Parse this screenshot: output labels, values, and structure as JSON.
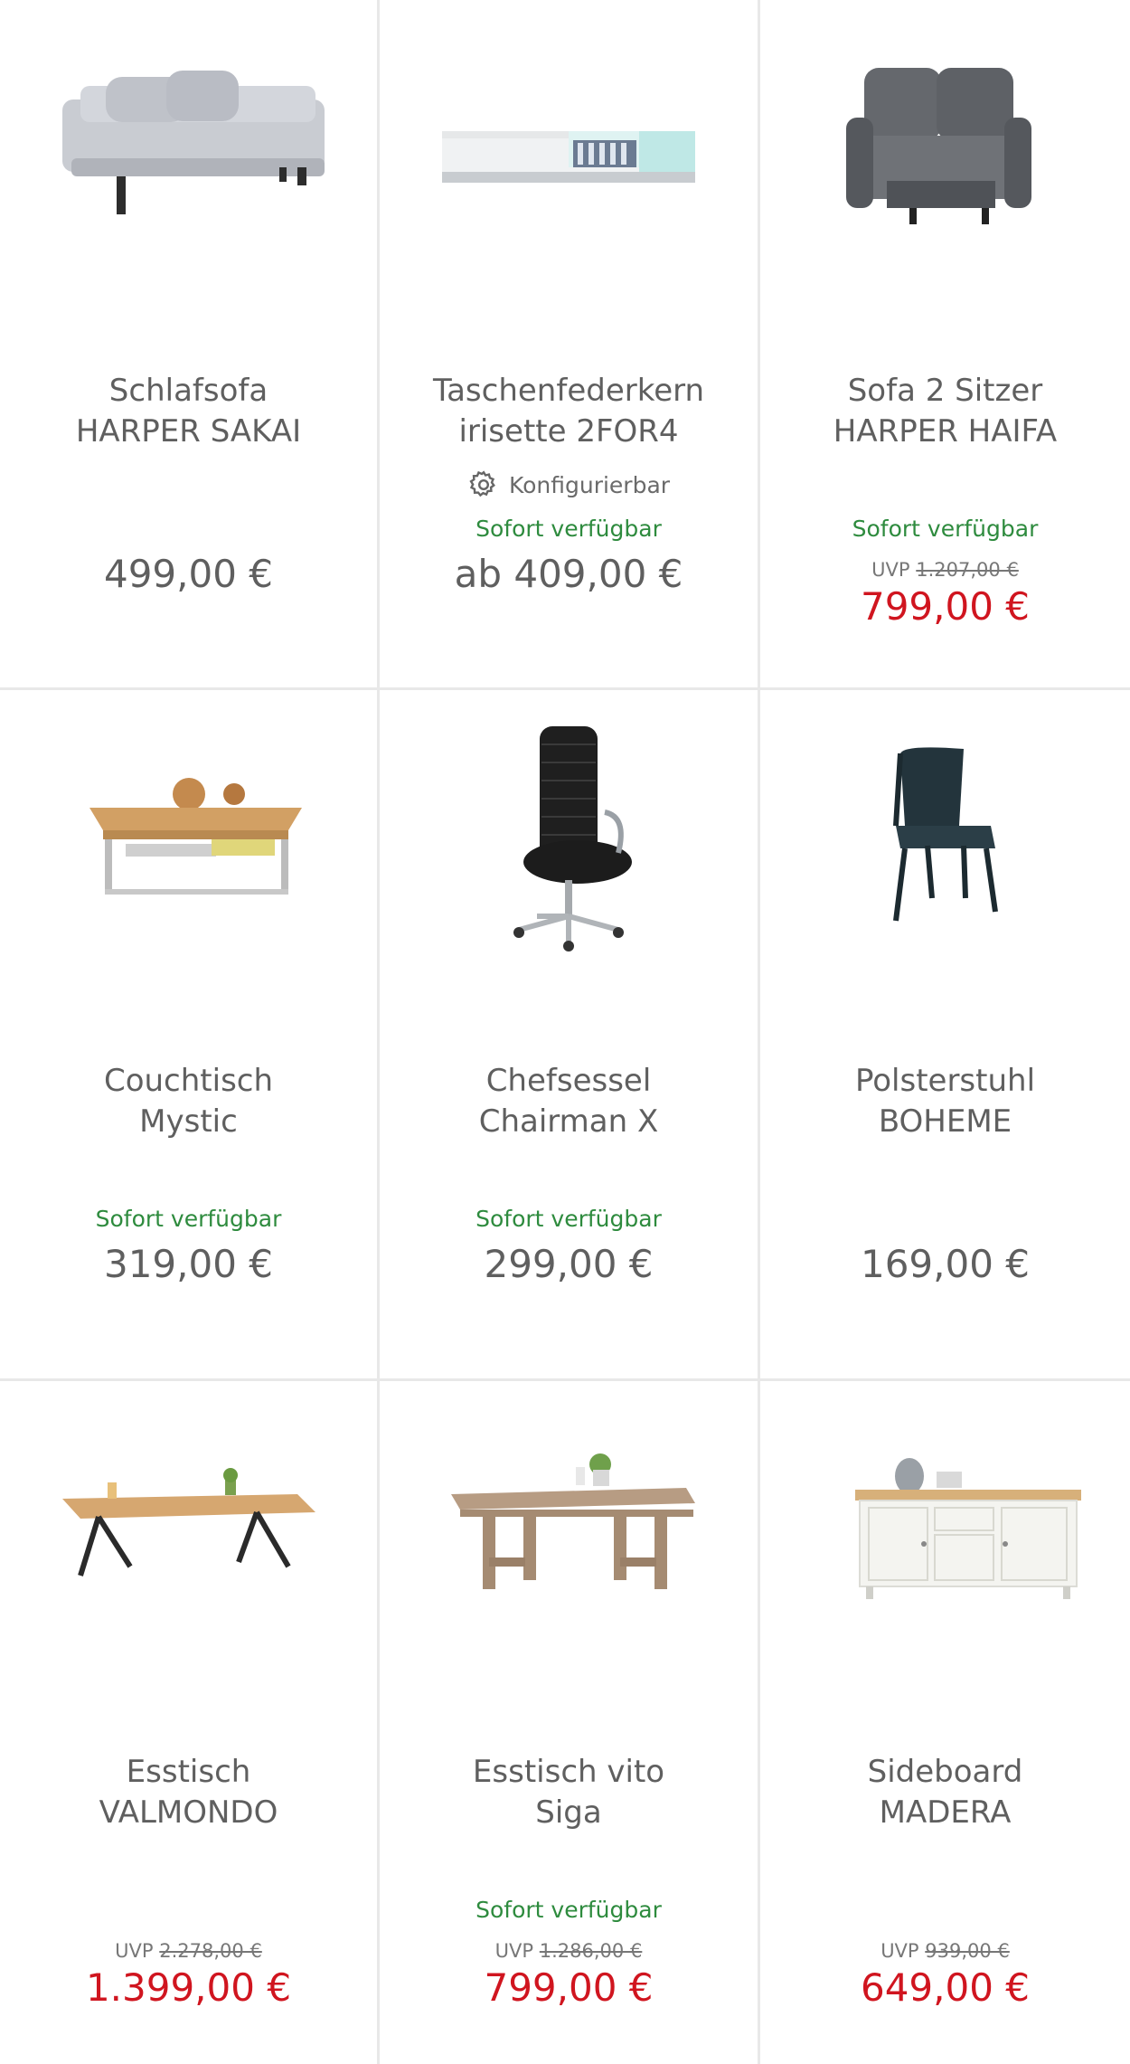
{
  "products": [
    {
      "title": "Schlafsofa\nHARPER SAKAI",
      "availability": "",
      "configurable": "",
      "uvp_label": "",
      "uvp_price": "",
      "price": "499,00 €",
      "image": "sofa-bed-icon"
    },
    {
      "title": "Taschenfederkern\nirisette 2FOR4",
      "availability": "Sofort verfügbar",
      "configurable": "Konfigurierbar",
      "uvp_label": "",
      "uvp_price": "",
      "price": "ab 409,00 €",
      "image": "mattress-icon"
    },
    {
      "title": "Sofa 2 Sitzer\nHARPER HAIFA",
      "availability": "Sofort verfügbar",
      "configurable": "",
      "uvp_label": "UVP",
      "uvp_price": "1.207,00 €",
      "price": "799,00 €",
      "image": "recliner-sofa-icon"
    },
    {
      "title": "Couchtisch\nMystic",
      "availability": "Sofort verfügbar",
      "configurable": "",
      "uvp_label": "",
      "uvp_price": "",
      "price": "319,00 €",
      "image": "coffee-table-icon"
    },
    {
      "title": "Chefsessel\nChairman X",
      "availability": "Sofort verfügbar",
      "configurable": "",
      "uvp_label": "",
      "uvp_price": "",
      "price": "299,00 €",
      "image": "office-chair-icon"
    },
    {
      "title": "Polsterstuhl\nBOHEME",
      "availability": "",
      "configurable": "",
      "uvp_label": "",
      "uvp_price": "",
      "price": "169,00 €",
      "image": "dining-chair-icon"
    },
    {
      "title": "Esstisch\nVALMONDO",
      "availability": "",
      "configurable": "",
      "uvp_label": "UVP",
      "uvp_price": "2.278,00 €",
      "price": "1.399,00 €",
      "image": "dining-table-icon"
    },
    {
      "title": "Esstisch vito\nSiga",
      "availability": "Sofort verfügbar",
      "configurable": "",
      "uvp_label": "UVP",
      "uvp_price": "1.286,00 €",
      "price": "799,00 €",
      "image": "wooden-table-icon"
    },
    {
      "title": "Sideboard\nMADERA",
      "availability": "",
      "configurable": "",
      "uvp_label": "UVP",
      "uvp_price": "939,00 €",
      "price": "649,00 €",
      "image": "sideboard-icon"
    }
  ],
  "colors": {
    "availability": "#2e8b3e",
    "sale_price": "#d0151f",
    "text": "#5f5f5f",
    "divider": "#e8e8e8"
  }
}
